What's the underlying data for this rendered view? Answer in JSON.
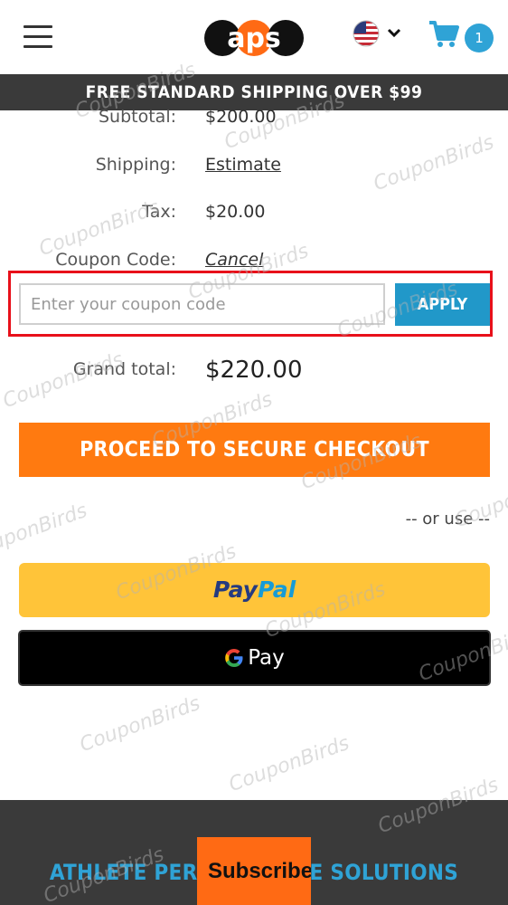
{
  "header": {
    "logo_text": "aps",
    "cart_count": "1",
    "icons": [
      "menu-icon",
      "us-flag-icon",
      "chevron-down-icon",
      "cart-icon"
    ]
  },
  "banner": {
    "text": "FREE STANDARD SHIPPING OVER $99"
  },
  "summary": {
    "subtotal_label": "Subtotal:",
    "subtotal_value": "$200.00",
    "shipping_label": "Shipping:",
    "shipping_link": "Estimate",
    "tax_label": "Tax:",
    "tax_value": "$20.00",
    "coupon_label": "Coupon Code:",
    "coupon_cancel": "Cancel"
  },
  "coupon": {
    "placeholder": "Enter your coupon code",
    "value": "",
    "apply_label": "APPLY"
  },
  "grand_total": {
    "label": "Grand total:",
    "value": "$220.00"
  },
  "checkout": {
    "label": "PROCEED TO SECURE CHECKOUT"
  },
  "alt_pay": {
    "or_use": "-- or use --",
    "paypal_part1": "Pay",
    "paypal_part2": "Pal",
    "gpay_label": "Pay"
  },
  "footer": {
    "text": "ATHLETE PERFORMANCE SOLUTIONS",
    "subscribe_label": "Subscribe"
  },
  "watermark": "CouponBirds",
  "colors": {
    "accent_orange": "#ff7a10",
    "accent_blue": "#2198c9",
    "highlight_red": "#e8101a",
    "paypal_yellow": "#ffc439",
    "banner_dark": "#3a3a3a"
  }
}
